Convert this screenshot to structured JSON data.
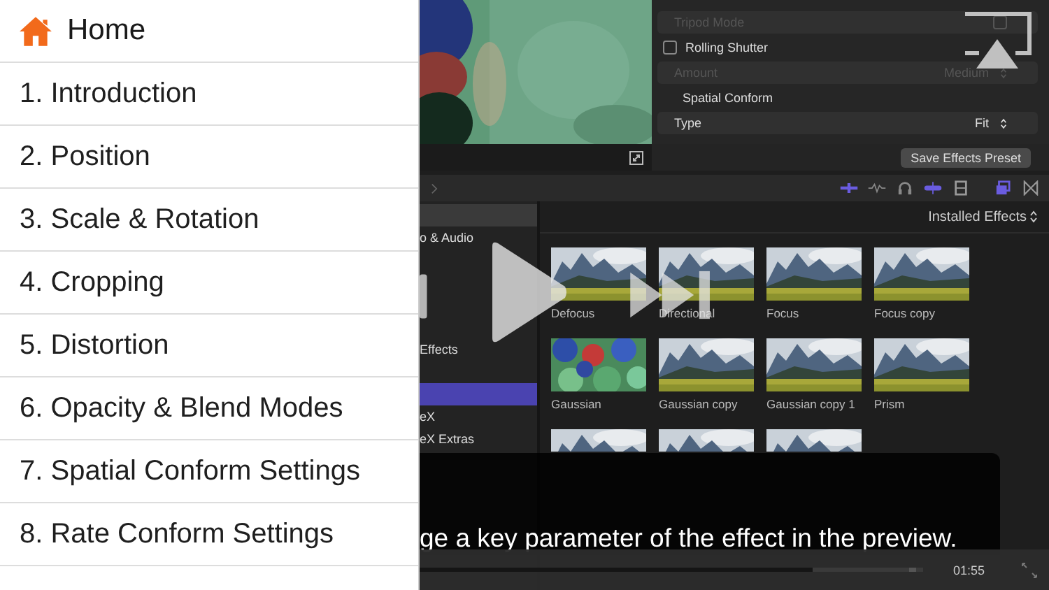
{
  "menu": {
    "home": "Home",
    "items": [
      {
        "label": "1. Introduction"
      },
      {
        "label": "2. Position"
      },
      {
        "label": "3. Scale & Rotation"
      },
      {
        "label": "4. Cropping"
      },
      {
        "label": "5. Distortion"
      },
      {
        "label": "6. Opacity & Blend Modes"
      },
      {
        "label": "7. Spatial Conform Settings"
      },
      {
        "label": "8. Rate Conform Settings"
      }
    ]
  },
  "video": {
    "inspector": {
      "rows": [
        {
          "kind": "check-setting",
          "label": "Tripod Mode",
          "checked": false
        },
        {
          "kind": "check-heading",
          "label": "Rolling Shutter",
          "checked": false
        },
        {
          "kind": "popup",
          "label": "Amount",
          "value": "Medium",
          "dimmed": true
        },
        {
          "kind": "heading",
          "label": "Spatial Conform"
        },
        {
          "kind": "popup",
          "label": "Type",
          "value": "Fit",
          "dimmed": false
        }
      ],
      "button": "Save Effects Preset"
    },
    "browser": {
      "sidebar": [
        {
          "selected": false
        },
        {
          "label": "o & Audio",
          "selected": false
        },
        {
          "selected": false
        },
        {
          "selected": false
        },
        {
          "selected": false
        },
        {
          "selected": false
        },
        {
          "label": "Effects",
          "selected": false
        },
        {
          "selected": false
        },
        {
          "selected": true
        },
        {
          "label": "eX",
          "selected": false
        },
        {
          "label": "eX Extras",
          "selected": false
        }
      ],
      "filter": "Installed Effects",
      "effects": [
        {
          "name": "Defocus",
          "kind": "landscape"
        },
        {
          "name": "Directional",
          "kind": "landscape"
        },
        {
          "name": "Focus",
          "kind": "landscape"
        },
        {
          "name": "Focus copy",
          "kind": "landscape"
        },
        {
          "name": "Gaussian",
          "kind": "blobs"
        },
        {
          "name": "Gaussian copy",
          "kind": "landscape"
        },
        {
          "name": "Gaussian copy 1",
          "kind": "landscape"
        },
        {
          "name": "Prism",
          "kind": "landscape"
        },
        {
          "kind": "landscape"
        },
        {
          "kind": "landscape"
        },
        {
          "kind": "landscape"
        }
      ]
    },
    "subtitle": "ge a key parameter of the effect in the preview.",
    "progress": {
      "level": 0.78
    },
    "time": "01:55"
  }
}
